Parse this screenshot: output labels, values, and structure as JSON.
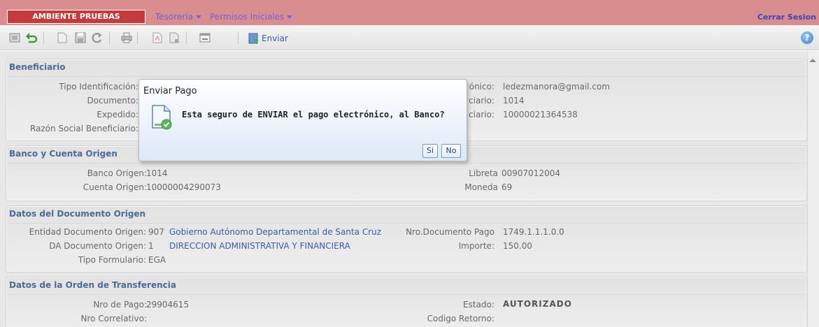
{
  "header": {
    "env_label": "AMBIENTE PRUEBAS",
    "menu": [
      {
        "label": "Tesorería"
      },
      {
        "label": "Permisos Iniciales"
      }
    ],
    "logout": "Cerrar Sesion"
  },
  "toolbar": {
    "send_label": "Enviar",
    "help": "?"
  },
  "panels": {
    "beneficiario": {
      "title": "Beneficiario",
      "fields_left": [
        {
          "label": "Tipo Identificación:"
        },
        {
          "label": "Documento:"
        },
        {
          "label": "Expedido:"
        },
        {
          "label": "Razón Social Beneficiario:"
        }
      ],
      "fields_right": [
        {
          "label": "ónico:",
          "value": "ledezmanora@gmail.com"
        },
        {
          "label": "ciario:",
          "value": "1014"
        },
        {
          "label": "ciario:",
          "value": "10000021364538"
        }
      ]
    },
    "banco": {
      "title": "Banco y Cuenta Origen",
      "fields_left": [
        {
          "label": "Banco Origen:",
          "value": "1014"
        },
        {
          "label": "Cuenta Origen:",
          "value": "10000004290073"
        }
      ],
      "fields_right": [
        {
          "label": "Libreta",
          "value": "00907012004"
        },
        {
          "label": "Moneda",
          "value": "69"
        }
      ]
    },
    "documento": {
      "title": "Datos del Documento Origen",
      "fields_left": [
        {
          "label": "Entidad Documento Origen:",
          "value": "907",
          "desc": "Gobierno Autónomo Departamental de Santa Cruz"
        },
        {
          "label": "DA Documento Origen:",
          "value": "1",
          "desc": "DIRECCION ADMINISTRATIVA Y FINANCIERA"
        },
        {
          "label": "Tipo Formulario:",
          "value": "EGA"
        }
      ],
      "fields_right": [
        {
          "label": "Nro.Documento Pago",
          "value": "1749.1.1.1.0.0"
        },
        {
          "label": "Importe:",
          "value": "150.00"
        }
      ]
    },
    "orden": {
      "title": "Datos de la Orden de Transferencia",
      "fields_left": [
        {
          "label": "Nro de Pago:",
          "value": "29904615"
        },
        {
          "label": "Nro Correlativo:",
          "value": ""
        }
      ],
      "fields_right": [
        {
          "label": "Estado:",
          "value": "AUTORIZADO"
        },
        {
          "label": "Codigo Retorno:",
          "value": ""
        }
      ]
    }
  },
  "dialog": {
    "title": "Enviar Pago",
    "message": "Esta seguro de ENVIAR el pago electrónico, al Banco?",
    "yes_label": "Si",
    "no_label": "No"
  },
  "colors": {
    "topbar": "#d88e8e",
    "env_badge": "#c33b3b",
    "panel_title": "#4a6a9a",
    "link": "#3a5ba8"
  }
}
